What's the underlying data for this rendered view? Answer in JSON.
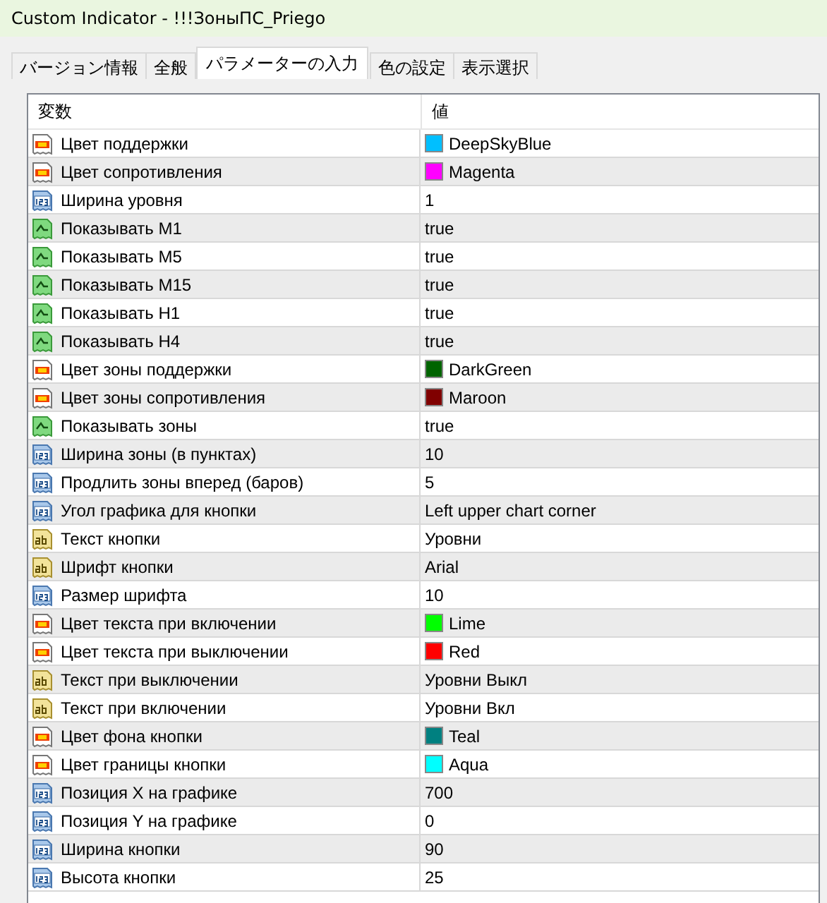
{
  "window": {
    "title": "Custom Indicator - !!!ЗоныПС_Priego"
  },
  "tabs": [
    {
      "label": "バージョン情報",
      "selected": false
    },
    {
      "label": "全般",
      "selected": false
    },
    {
      "label": "パラメーターの入力",
      "selected": true
    },
    {
      "label": "色の設定",
      "selected": false
    },
    {
      "label": "表示選択",
      "selected": false
    }
  ],
  "table": {
    "columns": [
      "変数",
      "値"
    ],
    "rows": [
      {
        "kind": "color",
        "name": "Цвет поддержки",
        "value": "DeepSkyBlue",
        "color": "#00bfff"
      },
      {
        "kind": "color",
        "name": "Цвет сопротивления",
        "value": "Magenta",
        "color": "#ff00ff"
      },
      {
        "kind": "int",
        "name": "Ширина уровня",
        "value": "1"
      },
      {
        "kind": "bool",
        "name": "Показывать M1",
        "value": "true"
      },
      {
        "kind": "bool",
        "name": "Показывать M5",
        "value": "true"
      },
      {
        "kind": "bool",
        "name": "Показывать M15",
        "value": "true"
      },
      {
        "kind": "bool",
        "name": "Показывать H1",
        "value": "true"
      },
      {
        "kind": "bool",
        "name": "Показывать H4",
        "value": "true"
      },
      {
        "kind": "color",
        "name": "Цвет зоны поддержки",
        "value": "DarkGreen",
        "color": "#006400"
      },
      {
        "kind": "color",
        "name": "Цвет зоны сопротивления",
        "value": "Maroon",
        "color": "#800000"
      },
      {
        "kind": "bool",
        "name": "Показывать зоны",
        "value": "true"
      },
      {
        "kind": "int",
        "name": "Ширина зоны (в пунктах)",
        "value": "10"
      },
      {
        "kind": "int",
        "name": "Продлить зоны вперед (баров)",
        "value": "5"
      },
      {
        "kind": "int",
        "name": "Угол графика для кнопки",
        "value": "Left upper chart corner"
      },
      {
        "kind": "string",
        "name": "Текст кнопки",
        "value": "Уровни"
      },
      {
        "kind": "string",
        "name": "Шрифт кнопки",
        "value": "Arial"
      },
      {
        "kind": "int",
        "name": "Размер шрифта",
        "value": "10"
      },
      {
        "kind": "color",
        "name": "Цвет текста при включении",
        "value": "Lime",
        "color": "#00ff00"
      },
      {
        "kind": "color",
        "name": "Цвет текста при выключении",
        "value": "Red",
        "color": "#ff0000"
      },
      {
        "kind": "string",
        "name": "Текст при выключении",
        "value": "Уровни Выкл"
      },
      {
        "kind": "string",
        "name": "Текст при включении",
        "value": "Уровни Вкл"
      },
      {
        "kind": "color",
        "name": "Цвет фона кнопки",
        "value": "Teal",
        "color": "#008080"
      },
      {
        "kind": "color",
        "name": "Цвет границы кнопки",
        "value": "Aqua",
        "color": "#00ffff"
      },
      {
        "kind": "int",
        "name": "Позиция X на графике",
        "value": "700"
      },
      {
        "kind": "int",
        "name": "Позиция Y на графике",
        "value": "0"
      },
      {
        "kind": "int",
        "name": "Ширина кнопки",
        "value": "90"
      },
      {
        "kind": "int",
        "name": "Высота кнопки",
        "value": "25"
      }
    ]
  }
}
